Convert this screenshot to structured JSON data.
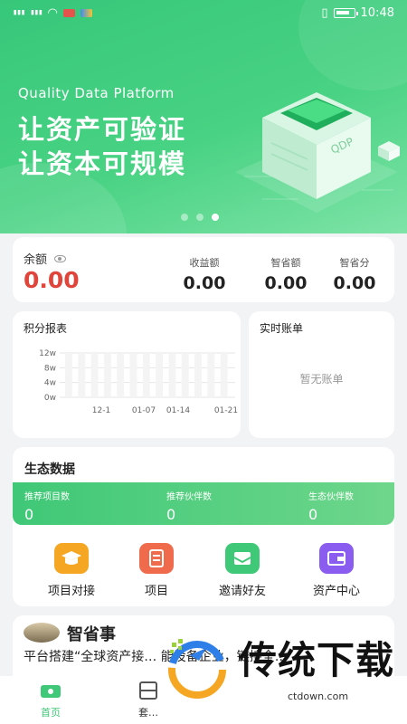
{
  "status_bar": {
    "signal1": "ℵ░l",
    "signal2": "ℵ░l",
    "time": "10:48"
  },
  "hero": {
    "subtitle": "Quality Data Platform",
    "title_line1": "让资产可验证",
    "title_line2": "让资本可规模",
    "illustration_label": "QDP",
    "carousel_dots": 3,
    "active_dot": 3
  },
  "balance": {
    "label": "余额",
    "value": "0.00",
    "stats": [
      {
        "label": "收益额",
        "value": "0.00"
      },
      {
        "label": "智省额",
        "value": "0.00"
      },
      {
        "label": "智省分",
        "value": "0.00"
      }
    ]
  },
  "points_chart": {
    "title": "积分报表"
  },
  "chart_data": {
    "type": "bar",
    "title": "积分报表",
    "categories": [
      "12-1",
      "01-07",
      "01-14",
      "01-21"
    ],
    "values": [
      0,
      0,
      0,
      0
    ],
    "y_ticks": [
      "12w",
      "8w",
      "4w",
      "0w"
    ],
    "ylim": [
      0,
      12
    ],
    "grid": true
  },
  "bill": {
    "title": "实时账单",
    "empty_text": "暂无账单"
  },
  "ecosystem": {
    "title": "生态数据",
    "stats": [
      {
        "label": "推荐项目数",
        "value": "0"
      },
      {
        "label": "推荐伙伴数",
        "value": "0"
      },
      {
        "label": "生态伙伴数",
        "value": "0"
      }
    ],
    "quick_links": [
      {
        "label": "项目对接",
        "icon": "graduation-cap-icon",
        "color": "#f5a623"
      },
      {
        "label": "项目",
        "icon": "clipboard-icon",
        "color": "#f06a4c"
      },
      {
        "label": "邀请好友",
        "icon": "envelope-icon",
        "color": "#3fc877"
      },
      {
        "label": "资产中心",
        "icon": "wallet-icon",
        "color": "#8a5cf0"
      }
    ]
  },
  "news": {
    "title": "智省事",
    "body": "平台搭建“全球资产接… 能设备企业，链接全…"
  },
  "tabbar": {
    "tabs": [
      {
        "label": "首页",
        "active": true
      },
      {
        "label": "套…",
        "active": false
      }
    ],
    "active_color": "#3fc877"
  },
  "watermark": {
    "text": "传统下载",
    "url": "ctdown.com"
  }
}
